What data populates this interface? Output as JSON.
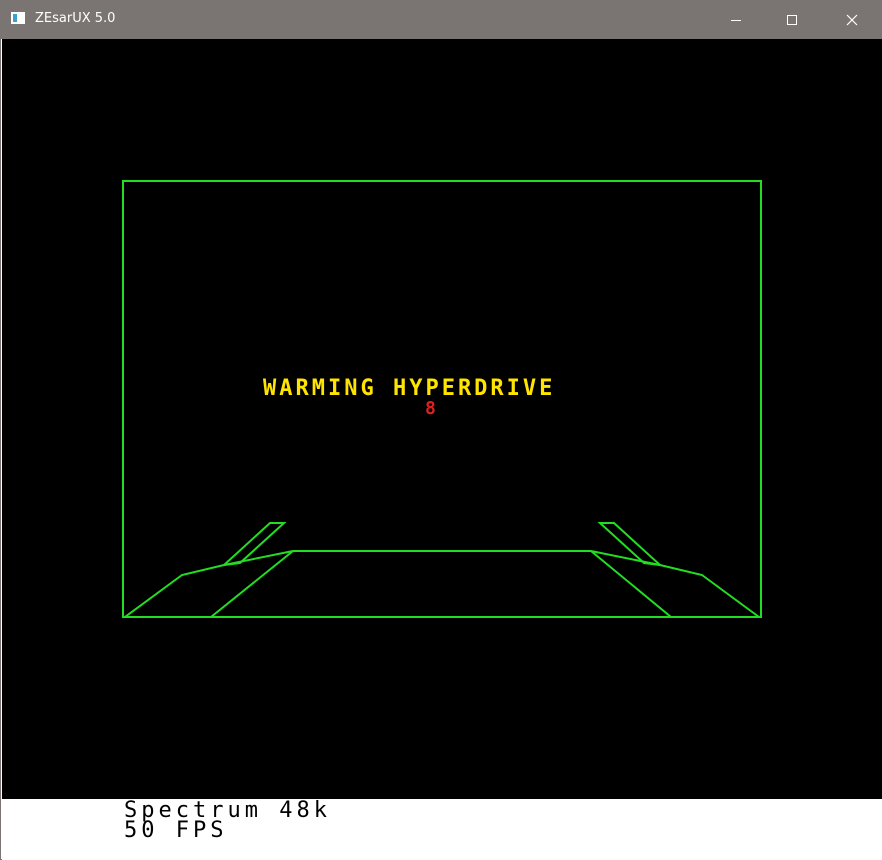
{
  "window": {
    "title": "ZEsarUX 5.0",
    "icon": "app-window-icon",
    "controls": [
      "minimize-icon",
      "maximize-icon",
      "close-icon"
    ]
  },
  "game": {
    "message": "WARMING HYPERDRIVE",
    "counter": "8",
    "colors": {
      "background": "#000000",
      "wireframe": "#22dd22",
      "message": "#ffe400",
      "counter": "#e02020"
    }
  },
  "status": {
    "machine": "Spectrum 48k",
    "fps": "50 FPS"
  }
}
